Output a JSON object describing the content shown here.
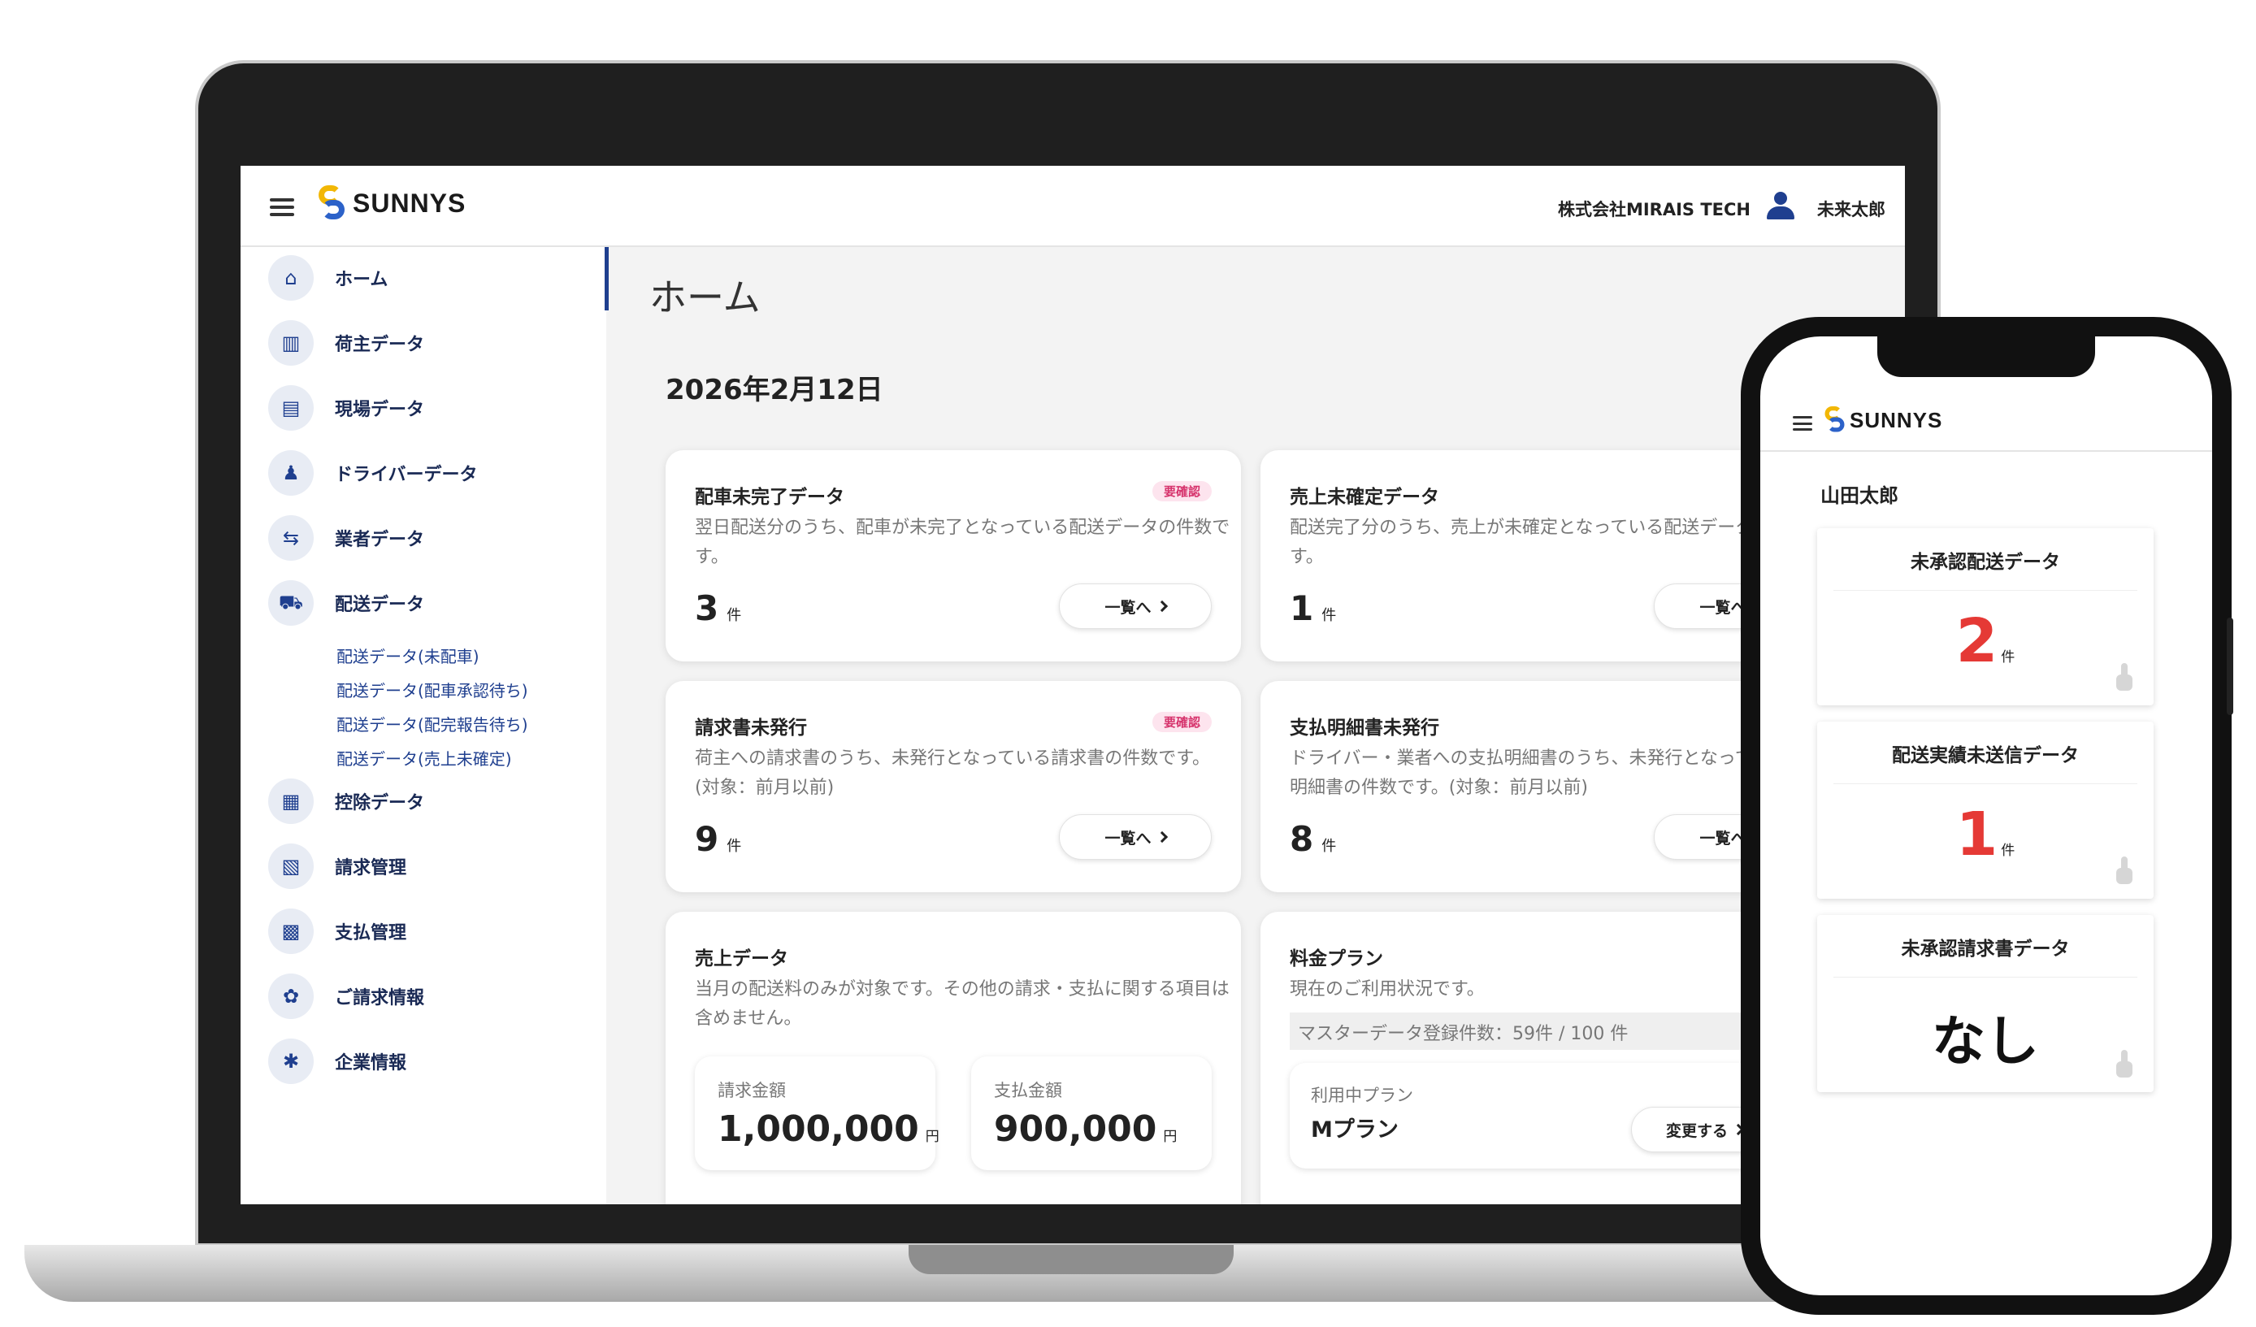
{
  "laptop": {
    "brand": "SUNNYS",
    "company": "株式会社MIRAIS TECH",
    "user": "未来太郎",
    "sidebar": {
      "items": [
        {
          "label": "ホーム",
          "icon": "home-icon",
          "glyph": "⌂"
        },
        {
          "label": "荷主データ",
          "icon": "building-icon",
          "glyph": "▥"
        },
        {
          "label": "現場データ",
          "icon": "document-icon",
          "glyph": "▤"
        },
        {
          "label": "ドライバーデータ",
          "icon": "driver-icon",
          "glyph": "♟"
        },
        {
          "label": "業者データ",
          "icon": "handshake-icon",
          "glyph": "⇆"
        },
        {
          "label": "配送データ",
          "icon": "delivery-icon",
          "glyph": "⛟"
        },
        {
          "label": "控除データ",
          "icon": "ledger-icon",
          "glyph": "▦"
        },
        {
          "label": "請求管理",
          "icon": "invoice-icon",
          "glyph": "▧"
        },
        {
          "label": "支払管理",
          "icon": "calculator-icon",
          "glyph": "▩"
        },
        {
          "label": "ご請求情報",
          "icon": "gear-icon",
          "glyph": "✿"
        },
        {
          "label": "企業情報",
          "icon": "settings-icon",
          "glyph": "✱"
        }
      ],
      "sub_items": [
        "配送データ(未配車)",
        "配送データ(配車承認待ち)",
        "配送データ(配完報告待ち)",
        "配送データ(売上未確定)"
      ]
    },
    "main": {
      "title": "ホーム",
      "date": "2026年2月12日",
      "cards": [
        {
          "title": "配車未完了データ",
          "badge": "要確認",
          "desc": "翌日配送分のうち、配車が未完了となっている配送データの件数です。",
          "count": "3",
          "unit": "件",
          "button": "一覧へ"
        },
        {
          "title": "売上未確定データ",
          "desc": "配送完了分のうち、売上が未確定となっている配送データの件数です。",
          "count": "1",
          "unit": "件",
          "button": "一覧へ"
        },
        {
          "title": "請求書未発行",
          "badge": "要確認",
          "desc": "荷主への請求書のうち、未発行となっている請求書の件数です。(対象：前月以前)",
          "count": "9",
          "unit": "件",
          "button": "一覧へ"
        },
        {
          "title": "支払明細書未発行",
          "desc": "ドライバー・業者への支払明細書のうち、未発行となっている支払明細書の件数です。(対象：前月以前)",
          "count": "8",
          "unit": "件",
          "button": "一覧へ"
        }
      ],
      "sales": {
        "title": "売上データ",
        "desc": "当月の配送料のみが対象です。その他の請求・支払に関する項目は含めません。",
        "billing_label": "請求金額",
        "billing_value": "1,000,000",
        "payment_label": "支払金額",
        "payment_value": "900,000",
        "unit": "円"
      },
      "plan": {
        "title": "料金プラン",
        "desc": "現在のご利用状況です。",
        "usage": "マスターデータ登録件数：59件 / 100 件",
        "current_label": "利用中プラン",
        "current_value": "Mプラン",
        "change_button": "変更する"
      }
    }
  },
  "phone": {
    "brand": "SUNNYS",
    "user": "山田太郎",
    "cards": [
      {
        "title": "未承認配送データ",
        "value": "2",
        "unit": "件"
      },
      {
        "title": "配送実績未送信データ",
        "value": "1",
        "unit": "件"
      },
      {
        "title": "未承認請求書データ",
        "value": "なし"
      }
    ]
  },
  "colors": {
    "accent": "#1f3f8f",
    "badge": "#d6336c",
    "alert": "#e53935",
    "logo_yellow": "#f2b705",
    "logo_blue": "#2c62c9"
  }
}
